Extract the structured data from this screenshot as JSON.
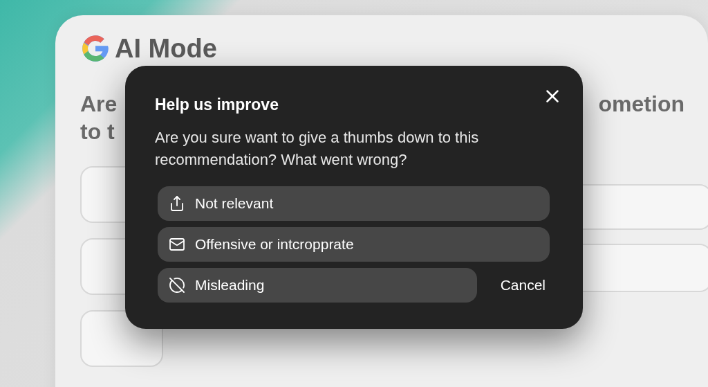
{
  "background": {
    "brand": "AI Mode",
    "line_left_1": "Are",
    "line_left_2": "to t",
    "line_right_1": "ometion"
  },
  "dialog": {
    "title": "Help us improve",
    "message": "Are you sure want to give a thumbs down to this recommendation? What went wrong?",
    "options": [
      {
        "label": "Not relevant"
      },
      {
        "label": "Offensive or intcropprate"
      },
      {
        "label": "Misleading"
      }
    ],
    "cancel": "Cancel"
  }
}
